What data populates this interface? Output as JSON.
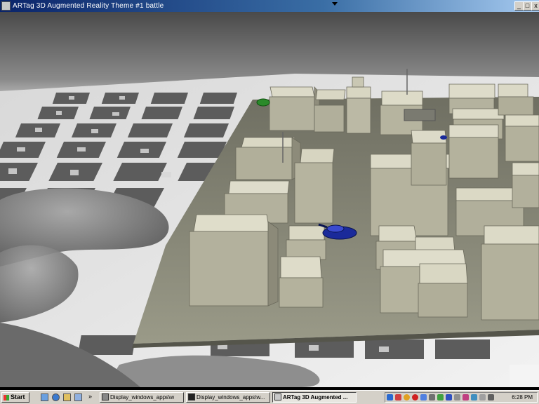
{
  "window": {
    "title": "ARTag 3D Augmented Reality   Theme #1   battle",
    "min_glyph": "_",
    "max_glyph": "□",
    "close_glyph": "x"
  },
  "scene": {
    "description_icon": "camera-feed",
    "markers_rows": 6
  },
  "taskbar": {
    "start_label": "Start",
    "overflow": "»",
    "tasks": [
      {
        "label": "Display_windows_apps\\w",
        "active": false
      },
      {
        "label": "Display_windows_apps\\w...",
        "active": false
      },
      {
        "label": "ARTag 3D Augmented ...",
        "active": true
      }
    ],
    "clock": "6:28 PM"
  },
  "colors": {
    "titlebar_start": "#0a246a",
    "board": "#8a8a78",
    "building": "#c9c6b2",
    "tank_green": "#2a8a2a",
    "tank_blue": "#1a2a9a"
  }
}
